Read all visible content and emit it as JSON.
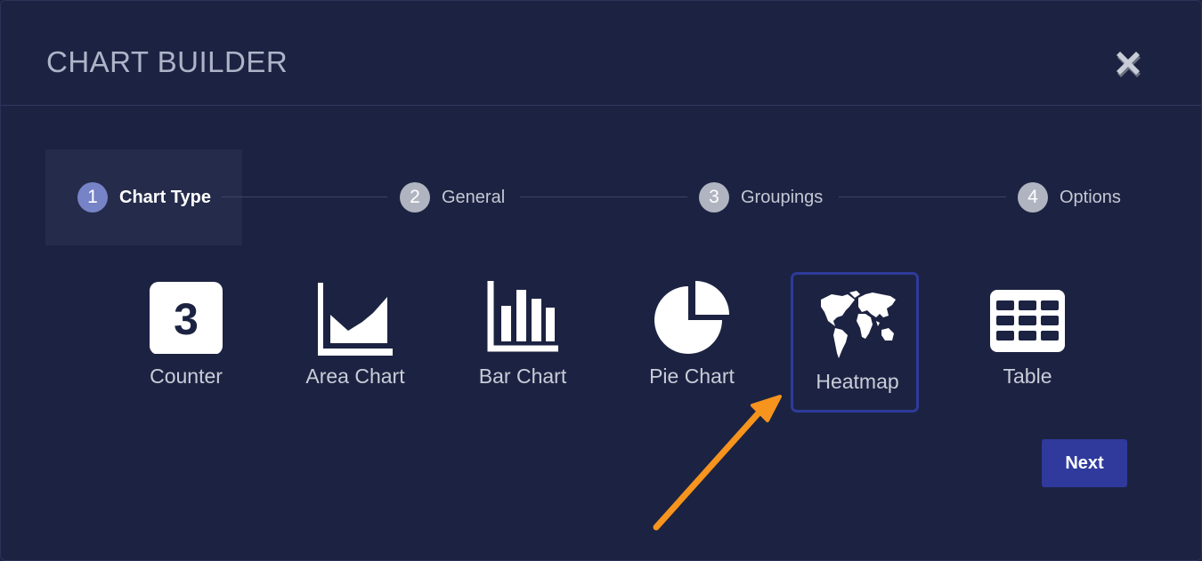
{
  "dialog": {
    "title": "CHART BUILDER",
    "close_icon": "close-icon"
  },
  "steps": [
    {
      "number": "1",
      "label": "Chart Type",
      "active": true
    },
    {
      "number": "2",
      "label": "General",
      "active": false
    },
    {
      "number": "3",
      "label": "Groupings",
      "active": false
    },
    {
      "number": "4",
      "label": "Options",
      "active": false
    }
  ],
  "chart_types": [
    {
      "label": "Counter",
      "icon": "counter-icon",
      "icon_text": "3",
      "selected": false
    },
    {
      "label": "Area Chart",
      "icon": "area-chart-icon",
      "selected": false
    },
    {
      "label": "Bar Chart",
      "icon": "bar-chart-icon",
      "selected": false
    },
    {
      "label": "Pie Chart",
      "icon": "pie-chart-icon",
      "selected": false
    },
    {
      "label": "Heatmap",
      "icon": "world-map-icon",
      "selected": true
    },
    {
      "label": "Table",
      "icon": "table-icon",
      "selected": false
    }
  ],
  "footer": {
    "next_label": "Next"
  },
  "colors": {
    "background": "#1c2342",
    "accent": "#2f3a9c",
    "active_step": "#7783c7",
    "annotation_arrow": "#f7941d"
  }
}
